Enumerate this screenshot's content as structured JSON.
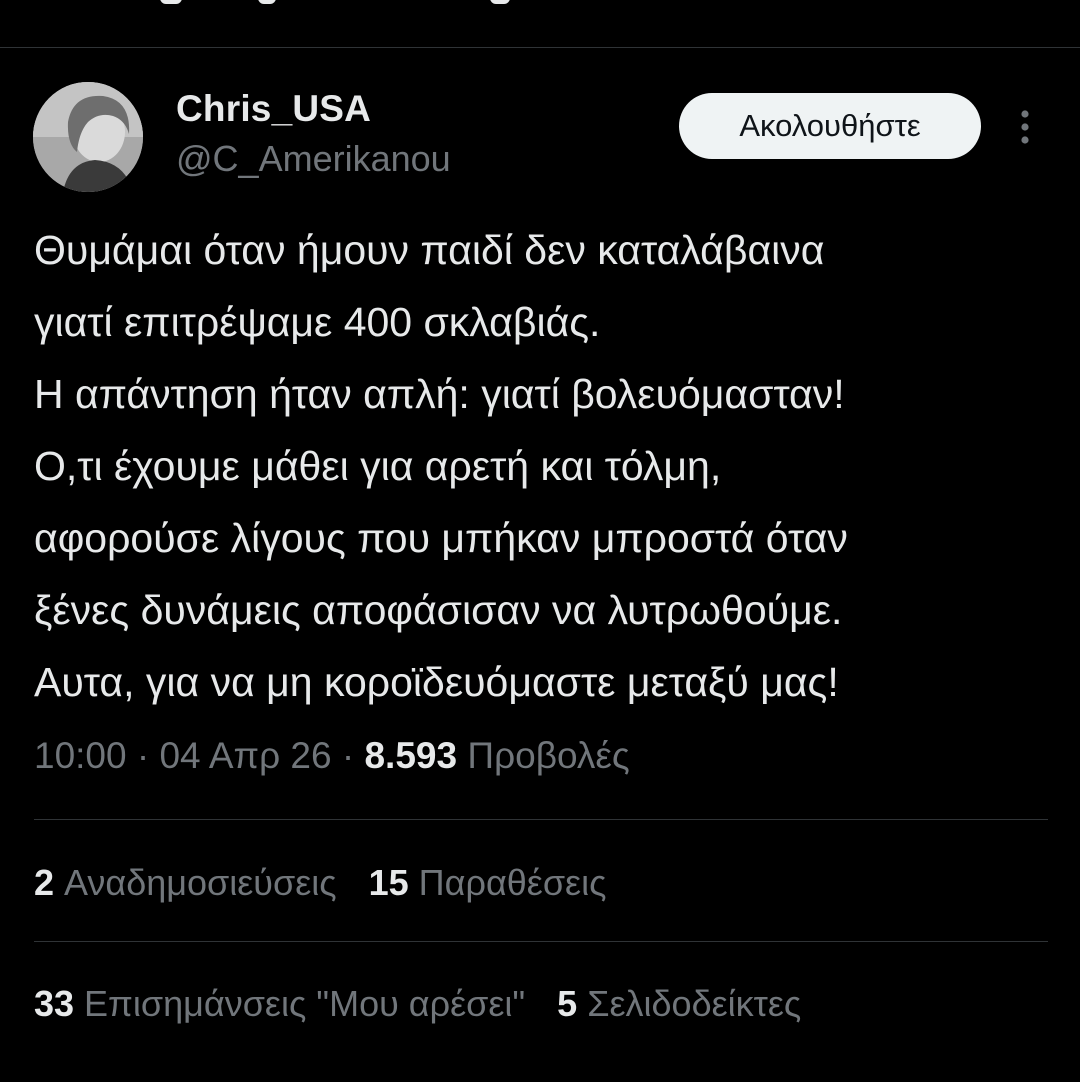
{
  "header": {
    "cut_off_fragment": "partially visible top bar"
  },
  "author": {
    "display_name": "Chris_USA",
    "handle": "@C_Amerikanou",
    "avatar_icon": "user-avatar-photo"
  },
  "actions": {
    "follow_label": "Ακολουθήστε",
    "more_icon": "more-vertical-icon"
  },
  "tweet": {
    "lines": [
      "Θυμάμαι όταν ήμουν παιδί δεν καταλάβαινα",
      "γιατί επιτρέψαμε 400 σκλαβιάς.",
      "Η απάντηση ήταν απλή: γιατί βολευόμασταν!",
      "Ο,τι έχουμε μάθει για αρετή και τόλμη,",
      "αφορούσε λίγους που μπήκαν μπροστά όταν",
      "ξένες δυνάμεις αποφάσισαν να λυτρωθούμε.",
      "Αυτα, για να μη κοροϊδευόμαστε μεταξύ μας!"
    ]
  },
  "meta": {
    "time": "10:00",
    "separator": " · ",
    "date": "04 Απρ 26",
    "views_count": "8.593",
    "views_label": "Προβολές"
  },
  "stats": {
    "reposts_count": "2",
    "reposts_label": "Αναδημοσιεύσεις",
    "quotes_count": "15",
    "quotes_label": "Παραθέσεις",
    "likes_count": "33",
    "likes_label": "Επισημάνσεις \"Μου αρέσει\"",
    "bookmarks_count": "5",
    "bookmarks_label": "Σελιδοδείκτες"
  },
  "colors": {
    "background": "#000000",
    "primary_text": "#e7e9ea",
    "secondary_text": "#71767b",
    "divider": "#2f3336",
    "follow_button_bg": "#eff3f4"
  }
}
